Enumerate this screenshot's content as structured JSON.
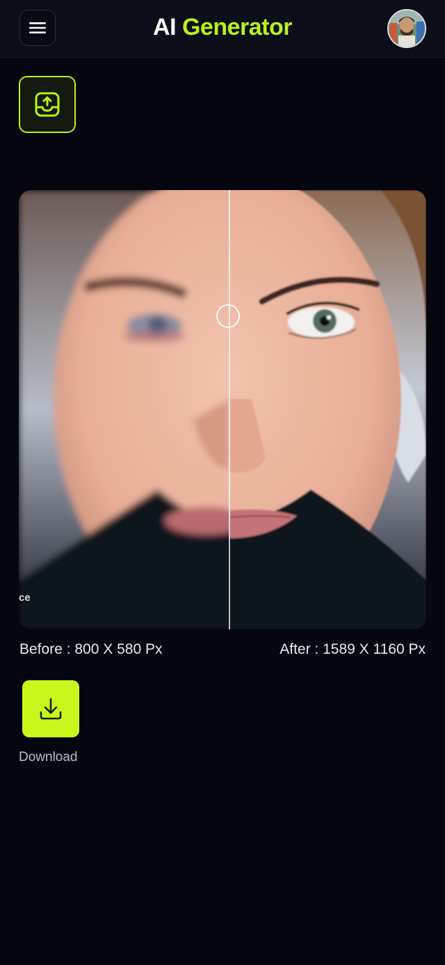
{
  "header": {
    "title_part1": "AI",
    "title_part2": "Generator",
    "menu_icon": "hamburger-menu-icon",
    "avatar_icon": "user-avatar"
  },
  "upload": {
    "icon": "upload-tray-icon"
  },
  "comparison": {
    "watermark": "ce",
    "before_label": "Before : 800 X 580 Px",
    "after_label": "After : 1589 X 1160 Px",
    "handle_icon": "slider-handle"
  },
  "download": {
    "label": "Download",
    "icon": "download-icon"
  },
  "colors": {
    "accent": "#b9f21d",
    "background": "#05060f",
    "header_bg": "#0c0e19"
  }
}
